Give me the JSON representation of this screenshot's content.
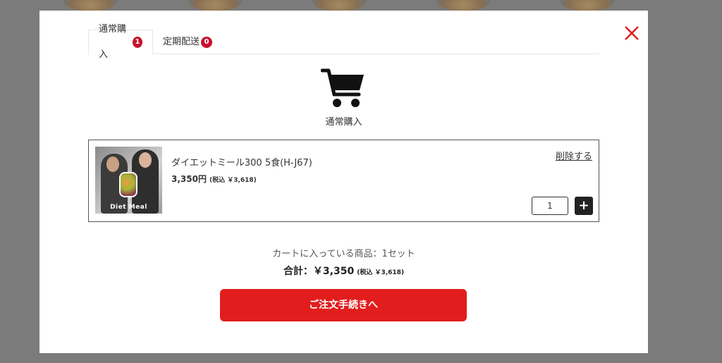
{
  "tabs": [
    {
      "label": "通常購入",
      "badge": "1"
    },
    {
      "label": "定期配送",
      "badge": "0"
    }
  ],
  "cart": {
    "heading": "通常購入",
    "icon": "cart-icon"
  },
  "item": {
    "image_brand": "Diet Meal",
    "name": "ダイエットミール300 5食(H-J67)",
    "price": "3,350円",
    "tax_note": "(税込 ￥3,618)",
    "delete_label": "削除する",
    "quantity": "1",
    "plus_label": "+"
  },
  "summary": {
    "count_text": "カートに入っている商品：1セット",
    "total_text": "合計：￥3,350",
    "total_tax": "(税込 ￥3,618)"
  },
  "checkout": {
    "label": "ご注文手続きへ"
  },
  "colors": {
    "accent_red": "#e21d1d",
    "badge_red": "#c8102e",
    "overlay": "#7b7b7b"
  }
}
